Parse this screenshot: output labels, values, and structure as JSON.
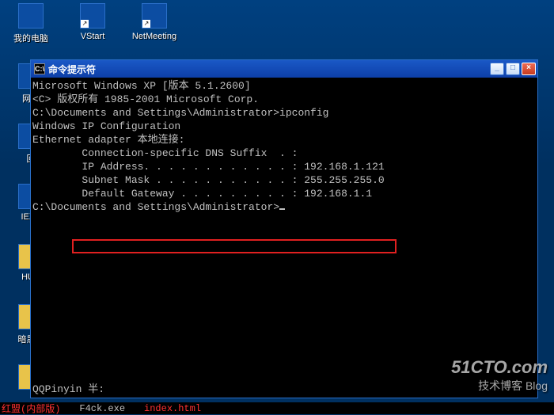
{
  "desktop": {
    "icons": [
      {
        "label": "我的电脑"
      },
      {
        "label": "VStart"
      },
      {
        "label": "NetMeeting"
      },
      {
        "label": "网上"
      },
      {
        "label": "回"
      },
      {
        "label": "IEXP"
      },
      {
        "label": ""
      },
      {
        "label": "HUC"
      },
      {
        "label": ""
      },
      {
        "label": "暗黑远"
      },
      {
        "label": ""
      }
    ]
  },
  "window": {
    "title_icon": "C:\\",
    "title": "命令提示符",
    "buttons": {
      "min": "_",
      "max": "□",
      "close": "×"
    }
  },
  "console": {
    "lines": [
      "Microsoft Windows XP [版本 5.1.2600]",
      "<C> 版权所有 1985-2001 Microsoft Corp.",
      "",
      "C:\\Documents and Settings\\Administrator>ipconfig",
      "",
      "",
      "Windows IP Configuration",
      "",
      "",
      "Ethernet adapter 本地连接:",
      "",
      "        Connection-specific DNS Suffix  . :",
      "        IP Address. . . . . . . . . . . . : 192.168.1.121",
      "        Subnet Mask . . . . . . . . . . . : 255.255.255.0",
      "        Default Gateway . . . . . . . . . : 192.168.1.1",
      "",
      "C:\\Documents and Settings\\Administrator>"
    ],
    "highlight_line_index": 12
  },
  "watermark": {
    "big": "51CTO.com",
    "small": "技术博客  Blog"
  },
  "taskbar": {
    "items": [
      {
        "text": "红盟(内部版)",
        "red": true
      },
      {
        "text": "F4ck.exe",
        "red": false
      },
      {
        "text": "index.html",
        "red": true
      }
    ]
  },
  "status_text": "QQPinyin 半:"
}
